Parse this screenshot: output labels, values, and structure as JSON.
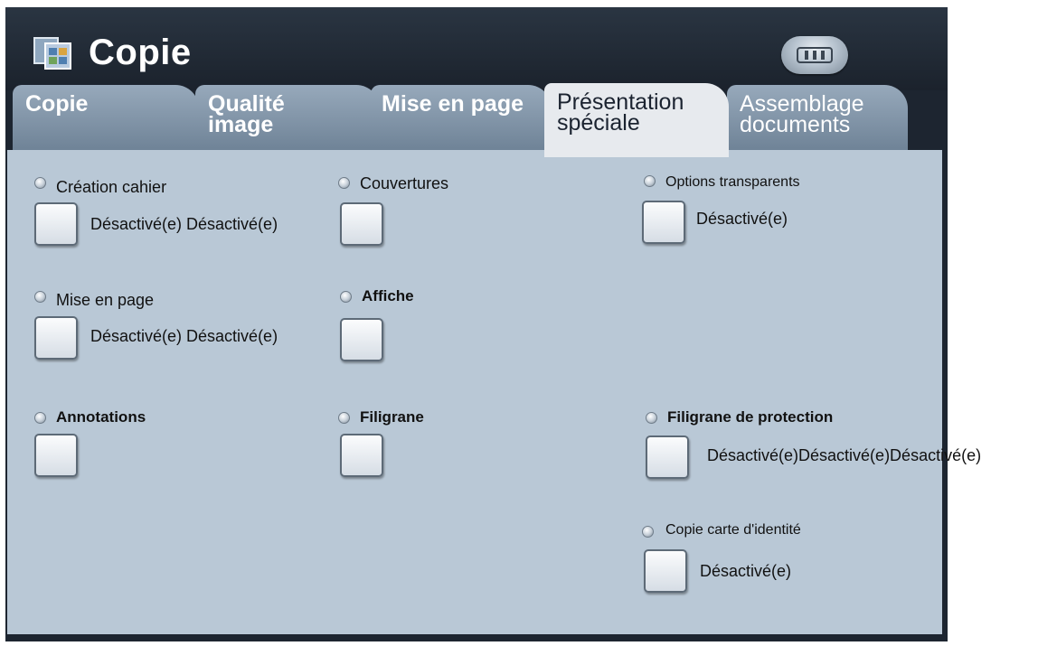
{
  "header": {
    "title": "Copie",
    "app_icon": "copy-app-icon",
    "jobs_icon": "job-status-icon"
  },
  "tabs": [
    {
      "line1": "Copie",
      "line2": ""
    },
    {
      "line1": "Qualité",
      "line2": "image"
    },
    {
      "line1": "Mise en page",
      "line2": ""
    },
    {
      "line1": "Présentation",
      "line2": "spéciale"
    },
    {
      "line1": "Assemblage",
      "line2": "documents"
    }
  ],
  "active_tab": "Présentation spéciale",
  "options": {
    "creation_cahier": {
      "label": "Création cahier",
      "value": "Désactivé(e) Désactivé(e)"
    },
    "couvertures": {
      "label": "Couvertures",
      "value": ""
    },
    "options_transparents": {
      "label": "Options transparents",
      "value": "Désactivé(e)"
    },
    "mise_en_page": {
      "label": "Mise en page",
      "value": "Désactivé(e) Désactivé(e)"
    },
    "affiche": {
      "label": "Affiche",
      "value": ""
    },
    "annotations": {
      "label": "Annotations",
      "value": ""
    },
    "filigrane": {
      "label": "Filigrane",
      "value": ""
    },
    "filigrane_protection": {
      "label": "Filigrane de protection",
      "value": "Désactivé(e)Désactivé(e)Désactivé(e)"
    },
    "copie_carte": {
      "label": "Copie carte d'identité",
      "value": "Désactivé(e)"
    }
  },
  "colors": {
    "header_bg": "#1d2530",
    "tab_inactive": "#8a9db0",
    "tab_active": "#e7eaee",
    "panel_bg": "#b9c8d6"
  }
}
